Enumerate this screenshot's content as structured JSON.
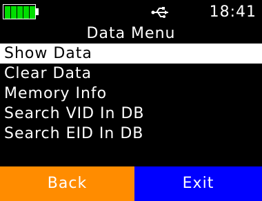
{
  "status_bar": {
    "battery_level": 1.0,
    "battery_cells": 5,
    "usb_icon": "usb-icon",
    "time": "18:41"
  },
  "title": "Data Menu",
  "menu": {
    "items": [
      {
        "label": "Show Data",
        "selected": true
      },
      {
        "label": "Clear Data",
        "selected": false
      },
      {
        "label": "Memory Info",
        "selected": false
      },
      {
        "label": "Search VID In DB",
        "selected": false
      },
      {
        "label": "Search EID In DB",
        "selected": false
      }
    ]
  },
  "softkeys": {
    "left_label": "Back",
    "right_label": "Exit"
  },
  "colors": {
    "background": "#000000",
    "text": "#ffffff",
    "selected_bg": "#ffffff",
    "selected_text": "#000000",
    "battery": "#00dd00",
    "back_button": "#ff8c00",
    "exit_button": "#0000ff"
  }
}
